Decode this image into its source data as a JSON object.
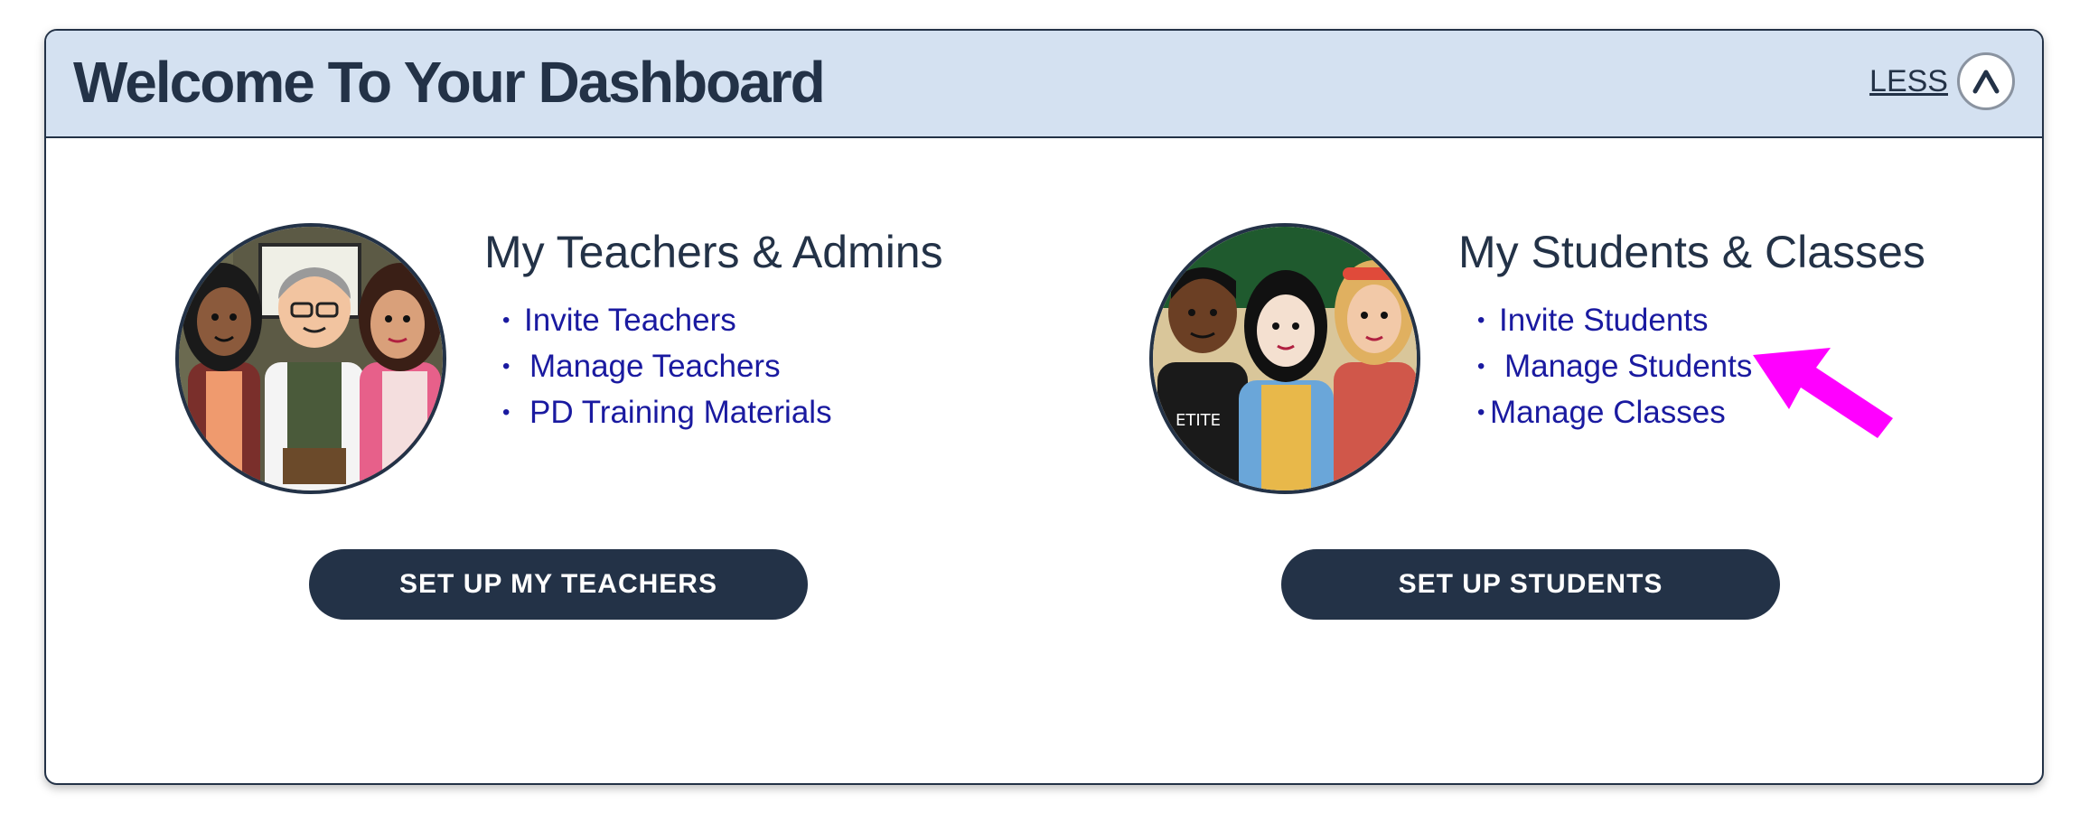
{
  "header": {
    "title": "Welcome To Your Dashboard",
    "toggle_label": "LESS",
    "toggle_icon": "chevron-up-icon"
  },
  "teachers_card": {
    "title": "My Teachers & Admins",
    "links": [
      "Invite Teachers",
      "Manage Teachers",
      "PD Training Materials"
    ],
    "button_label": "SET UP MY TEACHERS"
  },
  "students_card": {
    "title": "My Students & Classes",
    "links": [
      "Invite Students",
      "Manage Students",
      "Manage Classes"
    ],
    "button_label": "SET UP STUDENTS"
  },
  "annotation": {
    "arrow_color": "#ff00ff",
    "points_to": "Manage Students"
  },
  "colors": {
    "header_bg": "#d4e1f1",
    "navy": "#233247",
    "link": "#1a1aa0"
  }
}
